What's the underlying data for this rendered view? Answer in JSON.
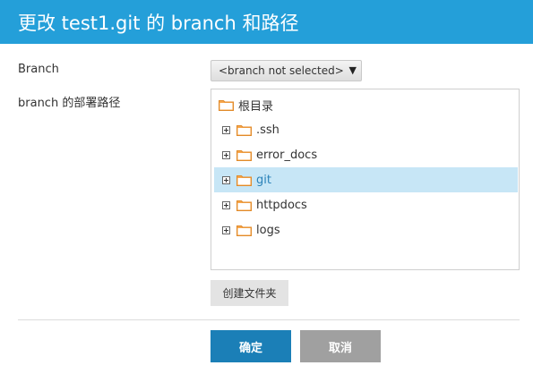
{
  "dialog": {
    "title": "更改 test1.git 的 branch 和路径"
  },
  "form": {
    "branch_label": "Branch",
    "branch_selected": "<branch not selected>",
    "path_label": "branch 的部署路径"
  },
  "tree": {
    "root": {
      "label": "根目录",
      "icon": "folder-icon"
    },
    "children": [
      {
        "label": ".ssh",
        "icon": "folder-icon",
        "expandable": true,
        "selected": false
      },
      {
        "label": "error_docs",
        "icon": "folder-icon",
        "expandable": true,
        "selected": false
      },
      {
        "label": "git",
        "icon": "folder-icon",
        "expandable": true,
        "selected": true
      },
      {
        "label": "httpdocs",
        "icon": "folder-icon",
        "expandable": true,
        "selected": false
      },
      {
        "label": "logs",
        "icon": "folder-icon",
        "expandable": true,
        "selected": false
      }
    ]
  },
  "actions": {
    "create_folder": "创建文件夹",
    "ok": "确定",
    "cancel": "取消"
  },
  "colors": {
    "titlebar": "#249fd9",
    "primary_button": "#1b7fb7",
    "secondary_button": "#a0a0a0",
    "selection": "#c7e6f6",
    "folder": "#f7a64a"
  }
}
